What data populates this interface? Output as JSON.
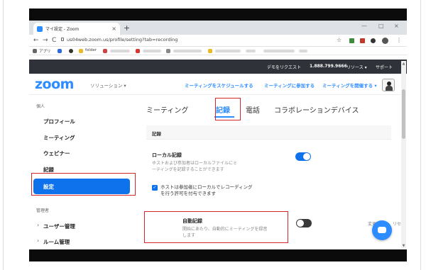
{
  "browser": {
    "tab_title": "マイ設定 - Zoom",
    "tab_close": "×",
    "new_tab": "+",
    "url": "us04web.zoom.us/profile/setting?tab=recording",
    "back": "←",
    "forward": "→",
    "reload": "C",
    "star": "☆",
    "menu": "⋮",
    "win_min": "—",
    "win_max": "□",
    "win_close": "×",
    "bookmarks": {
      "apps": "アプリ",
      "folder": "folder"
    }
  },
  "utility_bar": {
    "demo": "デモをリクエスト",
    "phone": "1.888.799.9666",
    "resources": "リソース ▾",
    "support": "サポート"
  },
  "header": {
    "logo": "zoom",
    "solutions": "ソリューション ▾",
    "schedule": "ミーティングをスケジュールする",
    "join": "ミーティングに参加する",
    "host": "ミーティングを開催する ▾"
  },
  "sidebar": {
    "personal_label": "個人",
    "items": [
      {
        "label": "プロフィール"
      },
      {
        "label": "ミーティング"
      },
      {
        "label": "ウェビナー"
      },
      {
        "label": "記録"
      },
      {
        "label": "設定"
      }
    ],
    "admin_label": "管理者",
    "admin_items": [
      {
        "label": "ユーザー管理"
      },
      {
        "label": "ルーム管理"
      }
    ],
    "caret": "›"
  },
  "main": {
    "tabs": [
      {
        "label": "ミーティング"
      },
      {
        "label": "記録"
      },
      {
        "label": "電話"
      },
      {
        "label": "コラボレーションデバイス"
      }
    ],
    "section_title": "記録",
    "local_recording": {
      "title": "ローカル記録",
      "desc_1": "ホストおよび参加者はローカルファイルにミ",
      "desc_2": "ーティングを記録することができます",
      "enabled": true
    },
    "host_permission": {
      "check_mark": "✓",
      "text_1": "ホストは参加者にローカルでレコーディング",
      "text_2": "を行う許可を付与できます",
      "checked": true
    },
    "auto_recording": {
      "title": "自動記録",
      "desc_1": "開始にあたり、自動的にミーティングを録音",
      "desc_2": "します",
      "enabled": false,
      "modified": "変更済み",
      "reset": "リセ"
    }
  },
  "colors": {
    "brand": "#2d8cff",
    "active": "#0e72ed",
    "highlight": "#d4262b"
  }
}
